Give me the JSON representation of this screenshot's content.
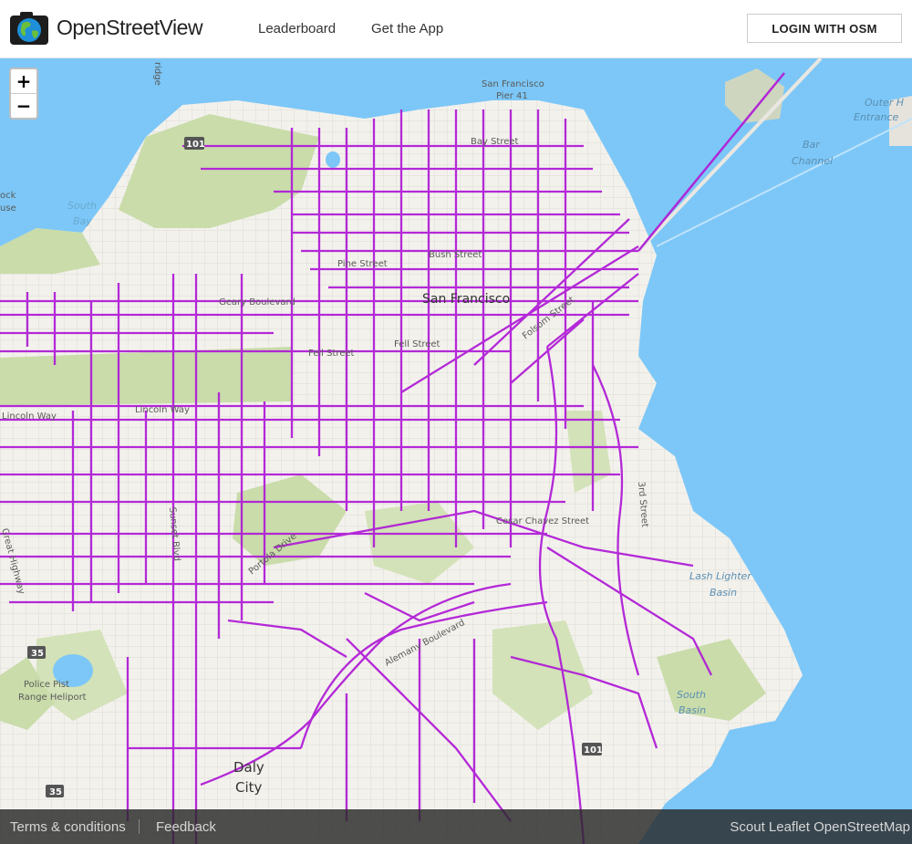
{
  "header": {
    "brand": "OpenStreetView",
    "nav": [
      "Leaderboard",
      "Get the App"
    ],
    "login_label": "LOGIN WITH OSM"
  },
  "map": {
    "zoom_in": "+",
    "zoom_out": "−",
    "coverage_color": "#b01fd6",
    "water_color": "#7cc7f7",
    "labels": {
      "city": "San Francisco",
      "daly": "Daly",
      "city2": "City",
      "south_bay": "South",
      "south_bay2": "Bay",
      "bar_channel": "Bar",
      "bar_channel2": "Channel",
      "outer_harbor": "Outer H",
      "entrance": "Entrance",
      "lash": "Lash Lighter",
      "basin": "Basin",
      "south_basin": "South",
      "south_basin2": "Basin",
      "pier": "San Francisco",
      "pier2": "Pier 41",
      "heliport": "Police Pist",
      "heliport2": "Range Heliport",
      "geary": "Geary Boulevard",
      "pine": "Pine Street",
      "bush": "Bush Street",
      "fell": "Fell Street",
      "fell2": "Fell Street",
      "lincoln": "Lincoln Way",
      "lincoln2": "Lincoln Way",
      "folsom": "Folsom Street",
      "cesar": "Cesar Chavez Street",
      "hwy": "Great Highway",
      "bay_st": "Bay Street",
      "ridge": "ridge",
      "shield35a": "35",
      "shield35b": "35",
      "shield101": "101",
      "shield101b": "101",
      "left1": "ock",
      "left2": "use",
      "alemany": "Alemany Boulevard",
      "third": "3rd Street",
      "portola": "Portola Drive",
      "sunset": "Sunset Blvd"
    }
  },
  "footer": {
    "terms": "Terms & conditions",
    "feedback": "Feedback",
    "attribution": "Scout Leaflet OpenStreetMap"
  }
}
